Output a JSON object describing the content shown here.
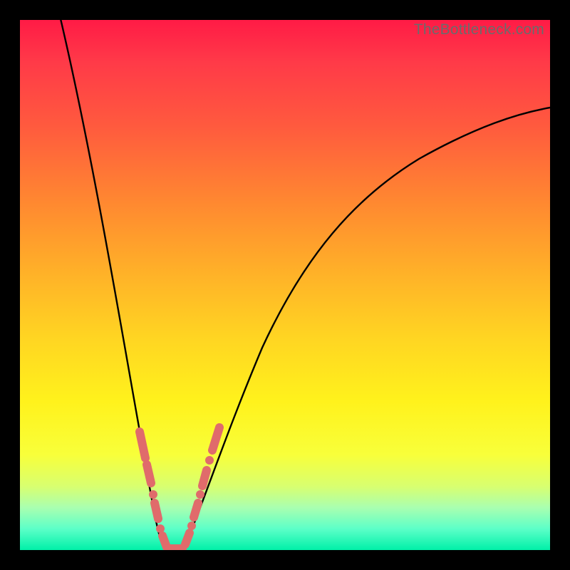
{
  "watermark": "TheBottleneck.com",
  "colors": {
    "background": "#000000",
    "gradient_top": "#ff1b46",
    "gradient_bottom": "#00f0a8",
    "curve": "#000000",
    "markers": "#e06b6b"
  },
  "chart_data": {
    "type": "line",
    "title": "",
    "xlabel": "",
    "ylabel": "",
    "xlim": [
      0,
      100
    ],
    "ylim": [
      0,
      100
    ],
    "grid": false,
    "legend": null,
    "series": [
      {
        "name": "bottleneck-curve",
        "x": [
          5,
          10,
          15,
          18,
          20,
          22,
          24,
          25,
          26,
          28,
          30,
          35,
          40,
          45,
          50,
          55,
          60,
          65,
          70,
          75,
          80,
          85,
          90,
          95,
          100
        ],
        "values": [
          100,
          77,
          50,
          33,
          22,
          12,
          5,
          1,
          0,
          0,
          5,
          20,
          34,
          45,
          53,
          60,
          66,
          70,
          74,
          77,
          79,
          81,
          82,
          83,
          84
        ]
      }
    ],
    "markers": {
      "name": "highlighted-points",
      "points": [
        {
          "x": 20.5,
          "y": 20
        },
        {
          "x": 21.5,
          "y": 15
        },
        {
          "x": 22.5,
          "y": 10
        },
        {
          "x": 23.5,
          "y": 6
        },
        {
          "x": 24.5,
          "y": 3
        },
        {
          "x": 25.5,
          "y": 1
        },
        {
          "x": 26.5,
          "y": 0
        },
        {
          "x": 27.5,
          "y": 0
        },
        {
          "x": 28.5,
          "y": 2
        },
        {
          "x": 29.5,
          "y": 5
        },
        {
          "x": 30.5,
          "y": 8
        },
        {
          "x": 31.5,
          "y": 12
        },
        {
          "x": 32.5,
          "y": 16
        },
        {
          "x": 33.5,
          "y": 20
        }
      ]
    }
  }
}
